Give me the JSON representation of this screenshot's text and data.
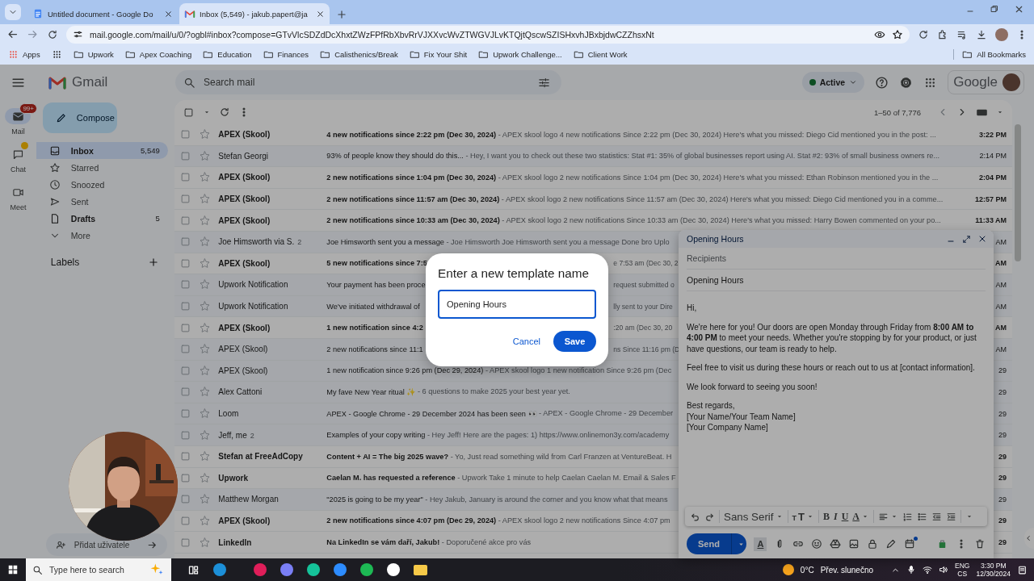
{
  "browser": {
    "tabs": [
      {
        "title": "Untitled document - Google Do",
        "kind": "doc",
        "selected": false
      },
      {
        "title": "Inbox (5,549) - jakub.papert@ja",
        "kind": "mail",
        "selected": true
      }
    ],
    "url": "mail.google.com/mail/u/0/?ogbl#inbox?compose=GTvVlcSDZdDcXhxtZWzFPfRbXbvRrVJXXvcWvZTWGVJLvKTQjtQscwSZISHxvhJBxbjdwCZZhsxNt",
    "bookmarks": [
      {
        "label": "Apps",
        "kind": "apps"
      },
      {
        "kind": "grid"
      },
      {
        "label": "Upwork",
        "kind": "folder"
      },
      {
        "label": "Apex Coaching",
        "kind": "folder"
      },
      {
        "label": "Education",
        "kind": "folder"
      },
      {
        "label": "Finances",
        "kind": "folder"
      },
      {
        "label": "Calisthenics/Break",
        "kind": "folder"
      },
      {
        "label": "Fix Your Shit",
        "kind": "folder"
      },
      {
        "label": "Upwork Challenge...",
        "kind": "folder"
      },
      {
        "label": "Client Work",
        "kind": "folder"
      }
    ],
    "all_bookmarks": "All Bookmarks"
  },
  "gmail": {
    "logo": "Gmail",
    "search_placeholder": "Search mail",
    "status": "Active",
    "account_brand": "Google",
    "rail": [
      {
        "label": "Mail",
        "badge": "99+",
        "kind": "mail",
        "selected": true
      },
      {
        "label": "Chat",
        "kind": "chat",
        "selected": false
      },
      {
        "label": "Meet",
        "kind": "meet",
        "selected": false
      }
    ],
    "compose_button": "Compose",
    "folders": [
      {
        "label": "Inbox",
        "count": "5,549",
        "kind": "inbox",
        "selected": true,
        "bold": true
      },
      {
        "label": "Starred",
        "kind": "star",
        "selected": false,
        "bold": false
      },
      {
        "label": "Snoozed",
        "kind": "clock",
        "selected": false,
        "bold": false
      },
      {
        "label": "Sent",
        "kind": "send",
        "selected": false,
        "bold": false
      },
      {
        "label": "Drafts",
        "count": "5",
        "kind": "file",
        "selected": false,
        "bold": true
      },
      {
        "label": "More",
        "kind": "more",
        "selected": false,
        "bold": false
      }
    ],
    "labels_title": "Labels",
    "add_user": "Přidat uživatele",
    "pagination": "1–50 of 7,776",
    "emails": [
      {
        "sender": "APEX (Skool)",
        "subject": "4 new notifications since 2:22 pm (Dec 30, 2024)",
        "snippet": " - APEX skool logo 4 new notifications Since 2:22 pm (Dec 30, 2024) Here's what you missed: Diego Cid mentioned you in the post: ...",
        "time": "3:22 PM",
        "unread": true
      },
      {
        "sender": "Stefan Georgi",
        "subject": "93% of people know they should do this...",
        "snippet": " - Hey, I want you to check out these two statistics: Stat #1: 35% of global businesses report using AI. Stat #2: 93% of small business owners re...",
        "time": "2:14 PM",
        "unread": false
      },
      {
        "sender": "APEX (Skool)",
        "subject": "2 new notifications since 1:04 pm (Dec 30, 2024)",
        "snippet": " - APEX skool logo 2 new notifications Since 1:04 pm (Dec 30, 2024) Here's what you missed: Ethan Robinson mentioned you in the ...",
        "time": "2:04 PM",
        "unread": true
      },
      {
        "sender": "APEX (Skool)",
        "subject": "2 new notifications since 11:57 am (Dec 30, 2024)",
        "snippet": " - APEX skool logo 2 new notifications Since 11:57 am (Dec 30, 2024) Here's what you missed: Diego Cid mentioned you in a comme...",
        "time": "12:57 PM",
        "unread": true
      },
      {
        "sender": "APEX (Skool)",
        "subject": "2 new notifications since 10:33 am (Dec 30, 2024)",
        "snippet": " - APEX skool logo 2 new notifications Since 10:33 am (Dec 30, 2024) Here's what you missed: Harry Bowen commented on your po...",
        "time": "11:33 AM",
        "unread": true
      },
      {
        "sender": "Joe Himsworth via S.",
        "count": "2",
        "subject": "Joe Himsworth sent you a message",
        "snippet": " - Joe Himsworth Joe Himsworth sent you a message Done bro Uplo",
        "time": "AM",
        "unread": false
      },
      {
        "sender": "APEX (Skool)",
        "subject": "5 new notifications since 7:5",
        "tail": "e 7:53 am (Dec 30, 2",
        "time": "AM",
        "unread": true
      },
      {
        "sender": "Upwork Notification",
        "subject": "Your payment has been proce",
        "tail": "request submitted o",
        "time": "AM",
        "unread": false
      },
      {
        "sender": "Upwork Notification",
        "subject": "We've initiated withdrawal of",
        "tail": "lly sent to your Dire",
        "time": "AM",
        "unread": false
      },
      {
        "sender": "APEX (Skool)",
        "subject": "1 new notification since 4:2",
        "tail": ":20 am (Dec 30, 20",
        "time": "AM",
        "unread": true
      },
      {
        "sender": "APEX (Skool)",
        "subject": "2 new notifications since 11:1",
        "tail": "ns Since 11:16 pm (D",
        "time": "AM",
        "unread": false
      },
      {
        "sender": "APEX (Skool)",
        "subject": "1 new notification since 9:26 pm (Dec 29, 2024)",
        "snippet": " - APEX skool logo 1 new notification Since 9:26 pm (Dec",
        "time": "29",
        "unread": false
      },
      {
        "sender": "Alex Cattoni",
        "subject": "My fave New Year ritual ✨",
        "snippet": " - 6 questions to make 2025 your best year yet.",
        "time": "29",
        "unread": false
      },
      {
        "sender": "Loom",
        "subject": "APEX - Google Chrome - 29 December 2024 has been seen 👀",
        "snippet": " - APEX - Google Chrome - 29 December",
        "time": "29",
        "unread": false
      },
      {
        "sender": "Jeff, me",
        "count": "2",
        "subject": "Examples of your copy writing",
        "snippet": " - Hey Jeff! Here are the pages: 1) https://www.onlinemon3y.com/academy",
        "time": "29",
        "unread": false
      },
      {
        "sender": "Stefan at FreeAdCopy",
        "subject": "Content + AI = The big 2025 wave?",
        "snippet": " - Yo, Just read something wild from Carl Franzen at VentureBeat. H",
        "time": "29",
        "unread": true
      },
      {
        "sender": "Upwork",
        "subject": "Caelan M. has requested a reference",
        "snippet": " - Upwork Take 1 minute to help Caelan Caelan M. Email & Sales F",
        "time": "29",
        "unread": true
      },
      {
        "sender": "Matthew Morgan",
        "subject": "\"2025 is going to be my year\"",
        "snippet": " - Hey Jakub, January is around the corner and you know what that means",
        "time": "29",
        "unread": false
      },
      {
        "sender": "APEX (Skool)",
        "subject": "2 new notifications since 4:07 pm (Dec 29, 2024)",
        "snippet": " - APEX skool logo 2 new notifications Since 4:07 pm",
        "time": "29",
        "unread": true
      },
      {
        "sender": "LinkedIn",
        "subject": "Na LinkedIn se vám daří, Jakub!",
        "snippet": " - Doporučené akce pro vás",
        "time": "29",
        "unread": true
      }
    ]
  },
  "compose": {
    "title": "Opening Hours",
    "recipients_placeholder": "Recipients",
    "subject": "Opening Hours",
    "body": [
      "Hi,",
      "We're here for you! Our doors are open Monday through Friday from **8:00 AM to 4:00 PM** to meet your needs. Whether you're stopping by for your product, or just have questions, our team is ready to help.",
      "Feel free to visit us during these hours or reach out to us at [contact information].",
      "We look forward to seeing you soon!"
    ],
    "signature": [
      "Best regards,",
      "[Your Name/Your Team Name]",
      "[Your Company Name]"
    ],
    "font": "Sans Serif",
    "size_button": "TT",
    "style_buttons": [
      "B",
      "I",
      "U"
    ],
    "color_button": "A",
    "send": "Send",
    "formatting_button": "A"
  },
  "dialog": {
    "title": "Enter a new template name",
    "value": "Opening Hours",
    "buttons": [
      {
        "label": "Cancel",
        "kind": "text"
      },
      {
        "label": "Save",
        "kind": "filled"
      }
    ]
  },
  "taskbar": {
    "search_placeholder": "Type here to search",
    "temperature": "0°C",
    "weather": "Přev. slunečno",
    "language": "ENG",
    "layout": "CS",
    "time": "3:30 PM",
    "date": "12/30/2024"
  }
}
